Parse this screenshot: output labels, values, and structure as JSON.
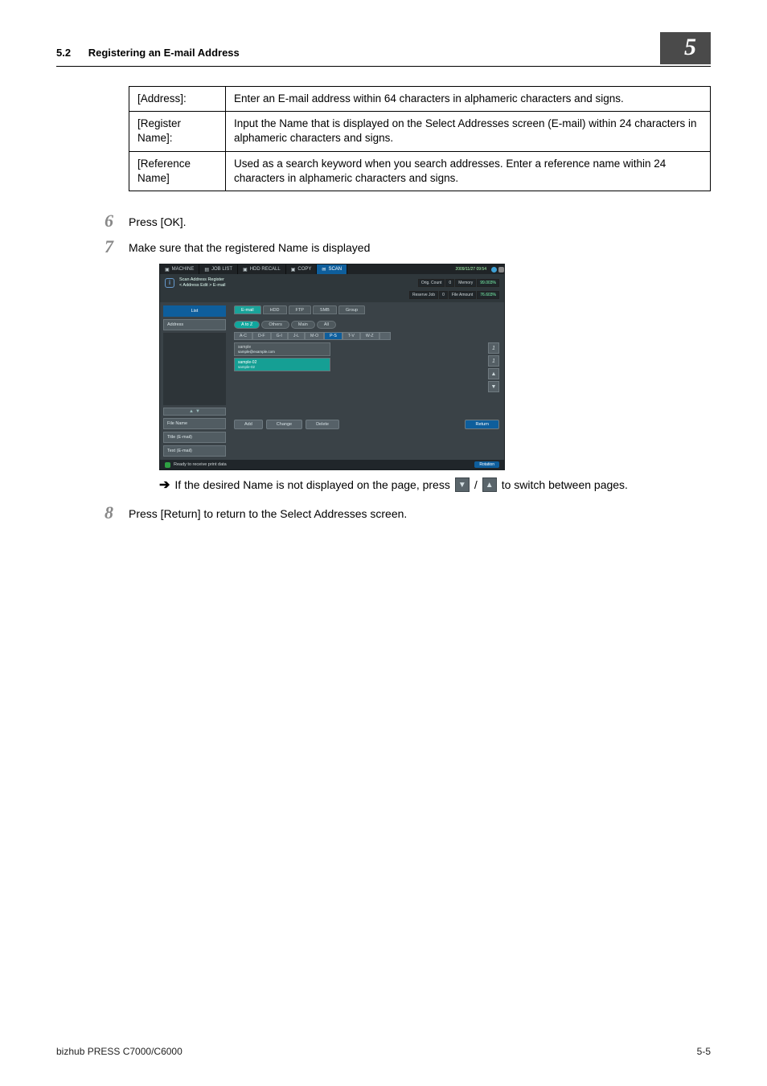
{
  "header": {
    "section_number": "5.2",
    "section_title": "Registering an E-mail Address",
    "chapter_number": "5"
  },
  "table": {
    "rows": [
      {
        "label": "[Address]:",
        "desc": "Enter an E-mail address within 64 characters in alphameric characters and signs."
      },
      {
        "label": "[Register Name]:",
        "desc": "Input the Name that is displayed on the Select Addresses screen (E-mail) within 24 characters in alphameric characters and signs."
      },
      {
        "label": "[Reference Name]",
        "desc": "Used as a search keyword when you search addresses.  Enter a reference name within 24 characters in alphameric characters and signs."
      }
    ]
  },
  "steps": {
    "s6": {
      "num": "6",
      "text": "Press [OK]."
    },
    "s7": {
      "num": "7",
      "text": "Make sure that the registered Name is displayed"
    },
    "s8": {
      "num": "8",
      "text": "Press [Return] to return to the Select Addresses screen."
    }
  },
  "note": {
    "arrow": "➔",
    "pre": "If the desired Name is not displayed on the page, press",
    "mid": "/",
    "post": "to switch between pages.",
    "down_glyph": "▼",
    "up_glyph": "▲"
  },
  "device": {
    "topbar": {
      "tabs": [
        "MACHINE",
        "JOB LIST",
        "HDD RECALL",
        "COPY",
        "SCAN"
      ],
      "selected": "SCAN",
      "datetime": "2009/11/27 09:54"
    },
    "info": {
      "title_line1": "Scan Address Register",
      "title_line2": "< Address Edit > E-mail",
      "stats": {
        "orig_count_label": "Orig. Count",
        "orig_count_val": "0",
        "memory_label": "Memory",
        "memory_val": "99.003%",
        "reserve_label": "Reserve Job",
        "reserve_val": "0",
        "file_label": "File Amount",
        "file_val": "76.603%"
      }
    },
    "sidebar": {
      "list_label": "List",
      "address_label": "Address",
      "nav_up": "▲",
      "nav_dn": "▼",
      "file_name": "File Name",
      "title_email": "Title (E-mail)",
      "text_email": "Text (E-mail)"
    },
    "main": {
      "tabs": [
        "E-mail",
        "HDD",
        "FTP",
        "SMB",
        "Group"
      ],
      "tab_selected": "E-mail",
      "filters": [
        "A to Z",
        "Others",
        "Main",
        "All"
      ],
      "filter_selected": "A to Z",
      "alpha": [
        "A-C",
        "D-F",
        "G-I",
        "J-L",
        "M-O",
        "P-S",
        "T-V",
        "W-Z",
        ""
      ],
      "alpha_selected": "P-S",
      "entries": [
        {
          "name": "sample",
          "sub": "sample@example.com",
          "selected": false
        },
        {
          "name": "sample-02",
          "sub": "sample-02",
          "selected": true
        }
      ],
      "rightcol": {
        "one": "1",
        "slash_one": "1",
        "up": "▲",
        "dn": "▼"
      },
      "buttons": {
        "add": "Add",
        "change": "Change",
        "delete": "Delete",
        "ret": "Return"
      }
    },
    "footer": {
      "status": "Ready to receive print data",
      "rotation": "Rotation"
    }
  },
  "page_footer": {
    "left": "bizhub PRESS C7000/C6000",
    "right": "5-5"
  }
}
